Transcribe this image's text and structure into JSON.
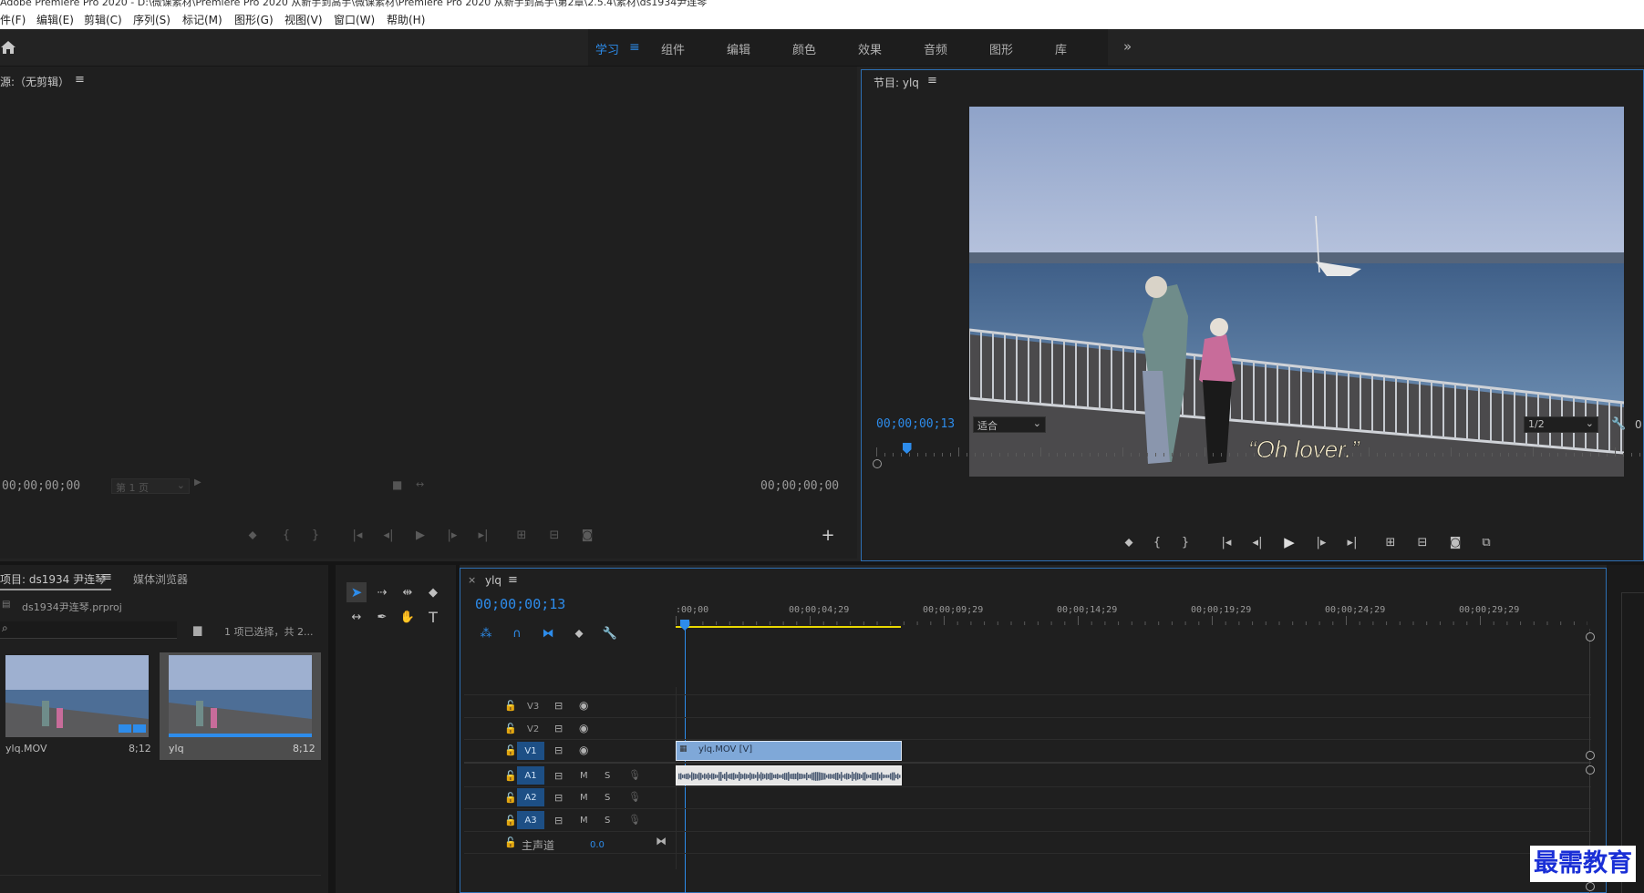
{
  "window": {
    "title": "Adobe Premiere Pro 2020 - D:\\微课素材\\Premiere Pro 2020 从新手到高手\\微课素材\\Premiere Pro 2020 从新手到高手\\第2章\\2.5.4\\素材\\ds1934尹连琴"
  },
  "menu": {
    "items": [
      "件(F)",
      "编辑(E)",
      "剪辑(C)",
      "序列(S)",
      "标记(M)",
      "图形(G)",
      "视图(V)",
      "窗口(W)",
      "帮助(H)"
    ]
  },
  "workspaces": {
    "tabs": [
      "学习",
      "组件",
      "编辑",
      "颜色",
      "效果",
      "音频",
      "图形",
      "库"
    ],
    "active": "学习",
    "more": "»"
  },
  "source_monitor": {
    "title": "源:（无剪辑）",
    "timecode_in": "00;00;00;00",
    "page_select": "第 1 页",
    "timecode_out": "00;00;00;00",
    "add_button": "+"
  },
  "program_monitor": {
    "title": "节目: ylq",
    "timecode": "00;00;00;13",
    "fit_select": "适合",
    "resolution_select": "1/2",
    "subtitle": "“Oh lover.”",
    "playhead_fraction": 0.04
  },
  "project_panel": {
    "tab_project": "项目: ds1934 尹连琴",
    "tab_media": "媒体浏览器",
    "project_file": "ds1934尹连琴.prproj",
    "selection_info": "1 项已选择，共 2...",
    "items": [
      {
        "name": "ylq.MOV",
        "duration": "8;12"
      },
      {
        "name": "ylq",
        "duration": "8;12"
      }
    ]
  },
  "timeline": {
    "sequence_name": "ylq",
    "timecode": "00;00;00;13",
    "ruler_labels": [
      ":00;00",
      "00;00;04;29",
      "00;00;09;29",
      "00;00;14;29",
      "00;00;19;29",
      "00;00;24;29",
      "00;00;29;29"
    ],
    "video_tracks": [
      "V3",
      "V2",
      "V1"
    ],
    "audio_tracks": [
      "A1",
      "A2",
      "A3"
    ],
    "mute_label": "M",
    "solo_label": "S",
    "master_label": "主声道",
    "master_value": "0.0",
    "video_clip_label": "ylq.MOV [V]"
  },
  "watermark": "最需教育",
  "colors": {
    "accent": "#2d8ceb",
    "clip_video": "#7fa8d8",
    "clip_audio": "#e6e6e6",
    "work_area": "#e8d800"
  }
}
